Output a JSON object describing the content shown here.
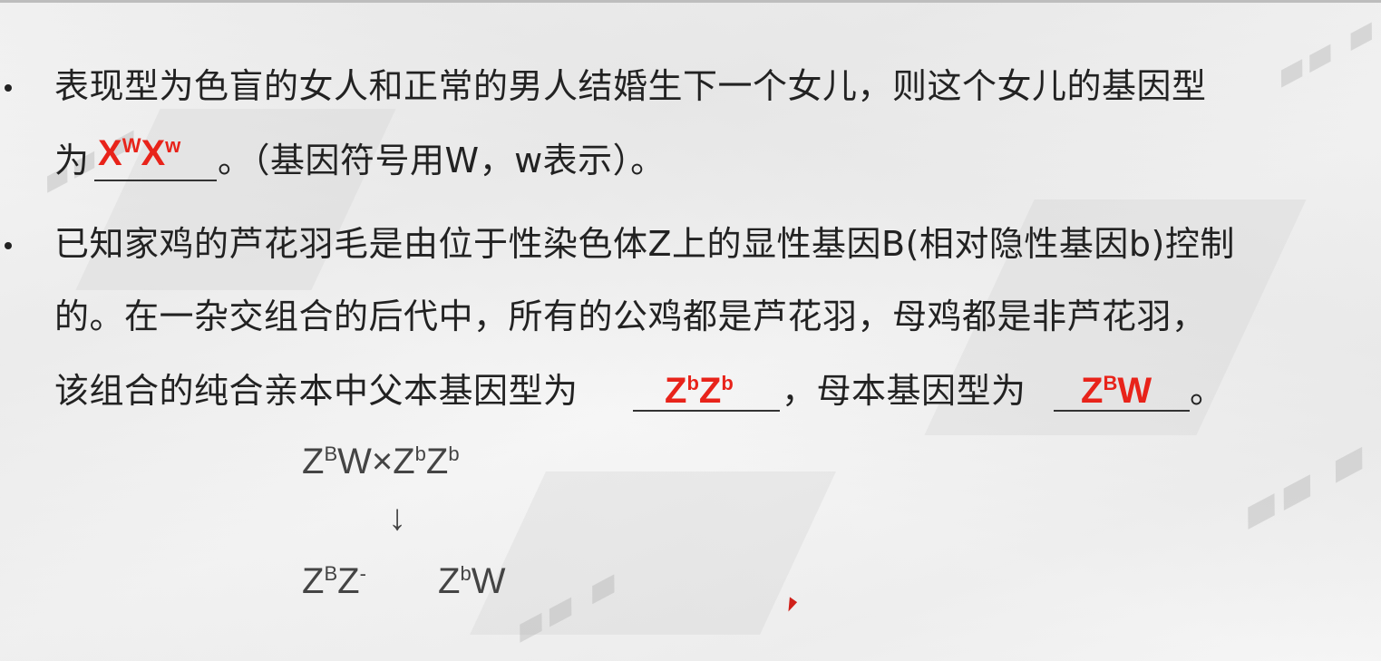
{
  "slide": {
    "bullets": [
      {
        "line1": "表现型为色盲的女人和正常的男人结婚生下一个女儿，则这个女儿的基因型",
        "line2_prefix": "为",
        "line2_suffix": "。（基因符号用W，w表示）。",
        "answer": {
          "base1": "X",
          "sup1": "W",
          "base2": "X",
          "sup2": "w"
        }
      },
      {
        "line1": "已知家鸡的芦花羽毛是由位于性染色体Z上的显性基因B(相对隐性基因b)控制",
        "line2": "的。在一杂交组合的后代中，所有的公鸡都是芦花羽，母鸡都是非芦花羽，",
        "line3_prefix": "该组合的纯合亲本中父本基因型为",
        "line3_mid": "，母本基因型为",
        "line3_suffix": "。",
        "answer_father": {
          "base1": "Z",
          "sup1": "b",
          "base2": "Z",
          "sup2": "b"
        },
        "answer_mother": {
          "base1": "Z",
          "sup1": "B",
          "base2": "W"
        }
      }
    ],
    "work": {
      "parents": {
        "a": "Z",
        "a_sup": "B",
        "b": "W×Z",
        "b_sup": "b",
        "c": "Z",
        "c_sup": "b"
      },
      "arrow": "↓",
      "offspring1": {
        "a": "Z",
        "a_sup": "B",
        "b": "Z",
        "b_sup": "-"
      },
      "offspring2": {
        "a": "Z",
        "a_sup": "b",
        "b": "W"
      }
    }
  }
}
